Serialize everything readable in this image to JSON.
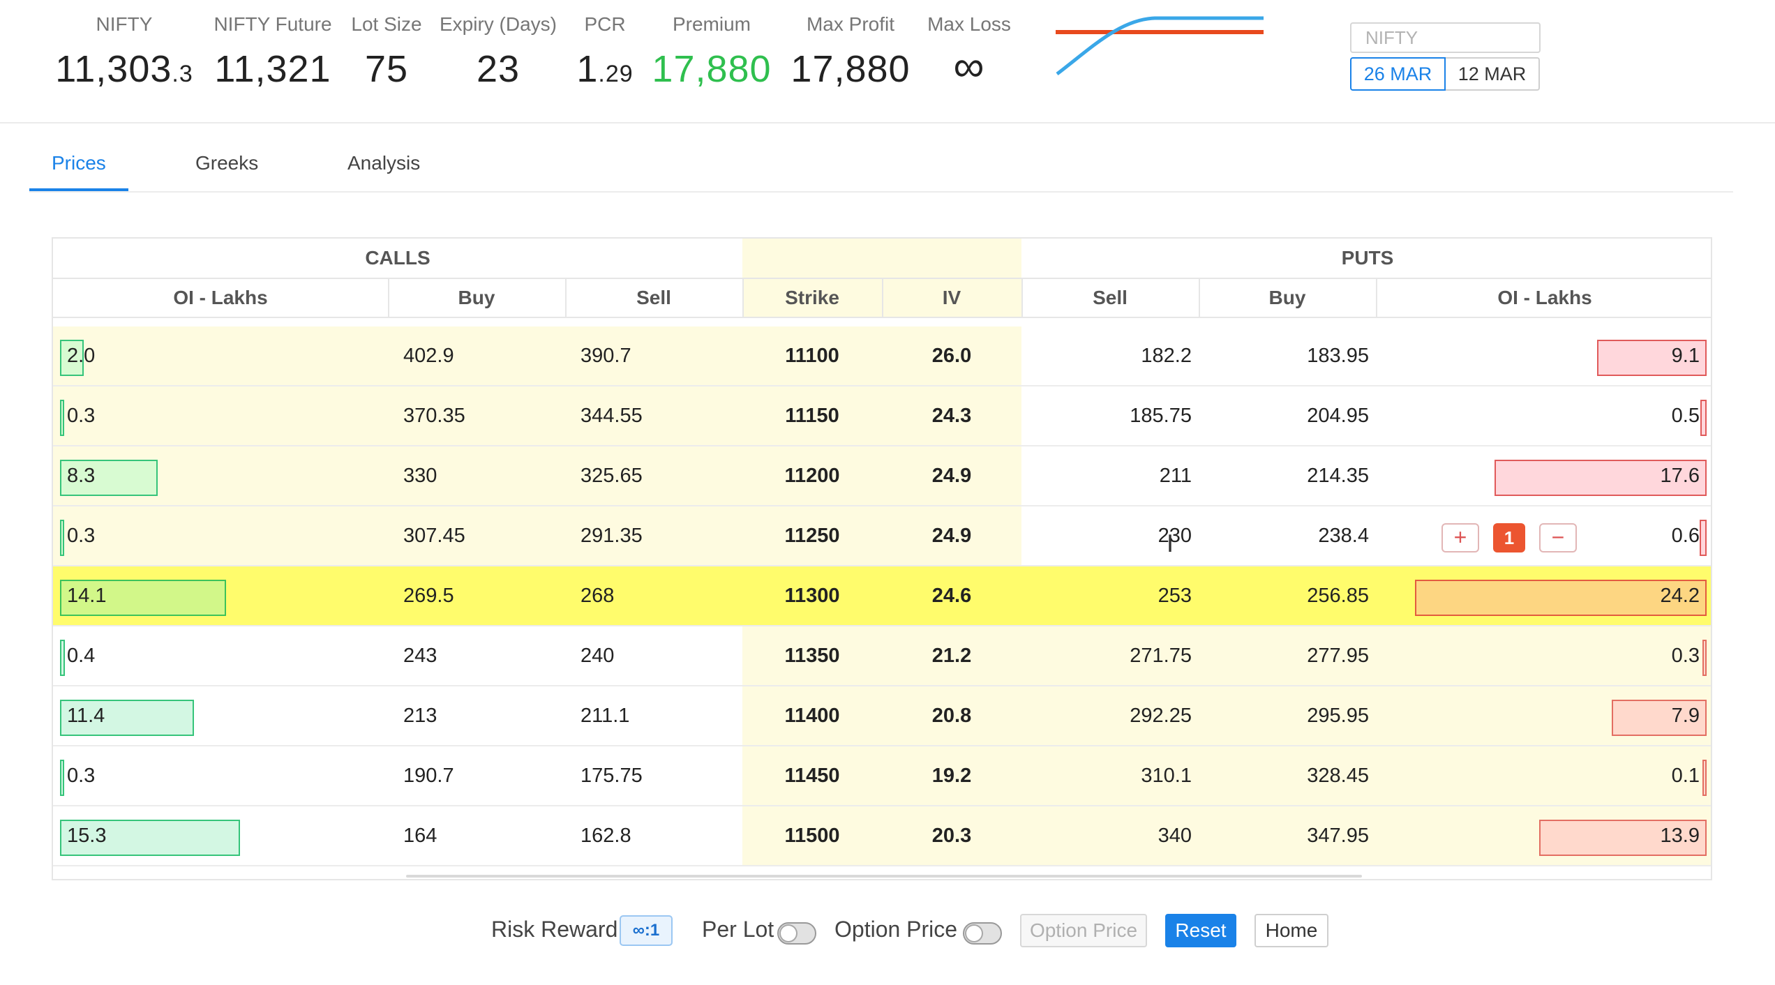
{
  "stats": [
    {
      "label": "NIFTY",
      "value_main": "11,303",
      "value_small": ".3"
    },
    {
      "label": "NIFTY Future",
      "value_main": "11,321",
      "value_small": ""
    },
    {
      "label": "Lot Size",
      "value_main": "75",
      "value_small": ""
    },
    {
      "label": "Expiry (Days)",
      "value_main": "23",
      "value_small": ""
    },
    {
      "label": "PCR",
      "value_main": "1",
      "value_small": ".29"
    },
    {
      "label": "Premium",
      "value_main": "17,880",
      "value_small": ""
    },
    {
      "label": "Max Profit",
      "value_main": "17,880",
      "value_small": ""
    },
    {
      "label": "Max Loss",
      "value_main": "∞",
      "value_small": ""
    }
  ],
  "colors": {
    "accent": "#1a82e8",
    "premium": "#2fbf4e",
    "atm_row": "#fffc6c",
    "chart_blue": "#3aa7e8",
    "chart_red": "#e8491d"
  },
  "symbol_input": {
    "placeholder": "NIFTY"
  },
  "expiries": [
    "26 MAR",
    "12 MAR"
  ],
  "selected_expiry": "26 MAR",
  "tabs": [
    {
      "label": "Prices",
      "active": true
    },
    {
      "label": "Greeks",
      "active": false
    },
    {
      "label": "Analysis",
      "active": false
    }
  ],
  "chain": {
    "group_headers": {
      "calls": "CALLS",
      "puts": "PUTS"
    },
    "columns": {
      "call_oi": "OI - Lakhs",
      "call_buy": "Buy",
      "call_sell": "Sell",
      "strike": "Strike",
      "iv": "IV",
      "put_sell": "Sell",
      "put_buy": "Buy",
      "put_oi": "OI - Lakhs"
    },
    "rows": [
      {
        "call_oi": "2.0",
        "call_buy": "402.9",
        "call_sell": "390.7",
        "strike": "11100",
        "iv": "26.0",
        "put_sell": "182.2",
        "put_buy": "183.95",
        "put_oi": "9.1"
      },
      {
        "call_oi": "0.3",
        "call_buy": "370.35",
        "call_sell": "344.55",
        "strike": "11150",
        "iv": "24.3",
        "put_sell": "185.75",
        "put_buy": "204.95",
        "put_oi": "0.5"
      },
      {
        "call_oi": "8.3",
        "call_buy": "330",
        "call_sell": "325.65",
        "strike": "11200",
        "iv": "24.9",
        "put_sell": "211",
        "put_buy": "214.35",
        "put_oi": "17.6"
      },
      {
        "call_oi": "0.3",
        "call_buy": "307.45",
        "call_sell": "291.35",
        "strike": "11250",
        "iv": "24.9",
        "put_sell": "230",
        "put_buy": "238.4",
        "put_oi": "0.6",
        "position_qty": "1"
      },
      {
        "call_oi": "14.1",
        "call_buy": "269.5",
        "call_sell": "268",
        "strike": "11300",
        "iv": "24.6",
        "put_sell": "253",
        "put_buy": "256.85",
        "put_oi": "24.2",
        "atm": true
      },
      {
        "call_oi": "0.4",
        "call_buy": "243",
        "call_sell": "240",
        "strike": "11350",
        "iv": "21.2",
        "put_sell": "271.75",
        "put_buy": "277.95",
        "put_oi": "0.3"
      },
      {
        "call_oi": "11.4",
        "call_buy": "213",
        "call_sell": "211.1",
        "strike": "11400",
        "iv": "20.8",
        "put_sell": "292.25",
        "put_buy": "295.95",
        "put_oi": "7.9"
      },
      {
        "call_oi": "0.3",
        "call_buy": "190.7",
        "call_sell": "175.75",
        "strike": "11450",
        "iv": "19.2",
        "put_sell": "310.1",
        "put_buy": "328.45",
        "put_oi": "0.1"
      },
      {
        "call_oi": "15.3",
        "call_buy": "164",
        "call_sell": "162.8",
        "strike": "11500",
        "iv": "20.3",
        "put_sell": "340",
        "put_buy": "347.95",
        "put_oi": "13.9"
      }
    ]
  },
  "footer": {
    "risk_reward_label": "Risk Reward",
    "risk_reward_value": "∞:1",
    "per_lot_label": "Per Lot",
    "per_lot_on": false,
    "option_price_label": "Option Price",
    "option_price_on": false,
    "option_price_button": "Option Price",
    "reset_button": "Reset",
    "home_button": "Home"
  }
}
